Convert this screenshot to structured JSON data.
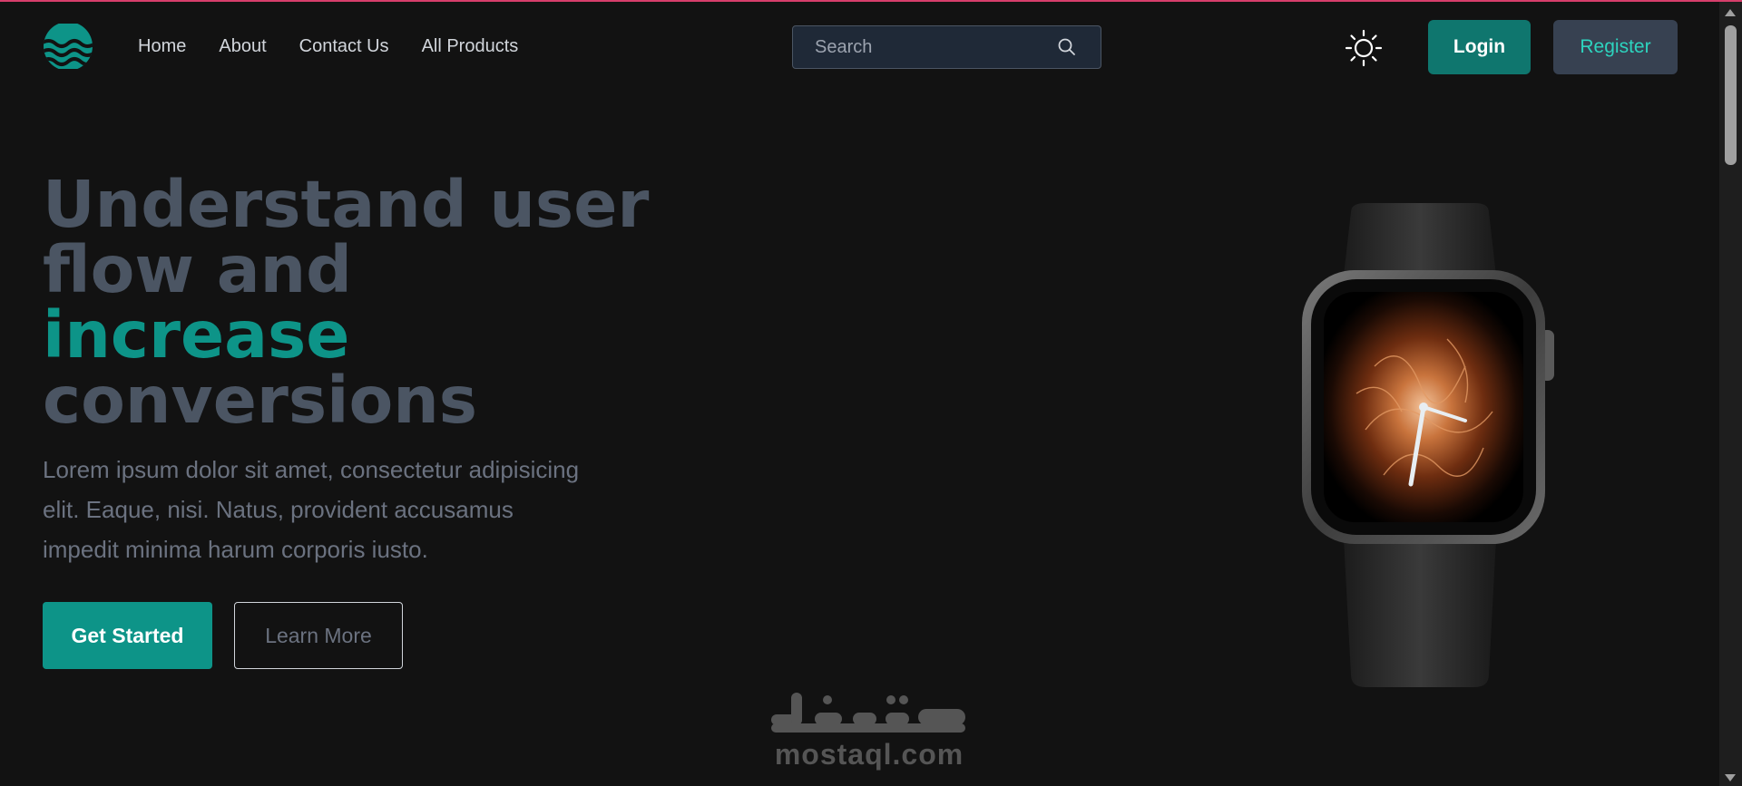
{
  "nav": {
    "links": [
      {
        "label": "Home"
      },
      {
        "label": "About"
      },
      {
        "label": "Contact Us"
      },
      {
        "label": "All Products"
      }
    ],
    "search_placeholder": "Search",
    "login_label": "Login",
    "register_label": "Register",
    "theme_icon": "sun-icon",
    "search_icon": "search-icon",
    "logo_icon": "wave-logo-icon"
  },
  "hero": {
    "title_line1": "Understand user",
    "title_line2": "flow and",
    "title_accent": "increase",
    "title_line4": "conversions",
    "description": "Lorem ipsum dolor sit amet, consectetur adipisicing elit. Eaque, nisi. Natus, provident accusamus impedit minima harum corporis iusto.",
    "primary_cta": "Get Started",
    "secondary_cta": "Learn More",
    "image_icon": "smartwatch-image"
  },
  "watermark": {
    "arabic": "مستقل",
    "domain": "mostaql.com"
  },
  "colors": {
    "accent": "#0d9488",
    "login_bg": "#0f766e",
    "register_bg": "#374151",
    "register_text": "#2dd4bf",
    "background": "#121212",
    "top_border": "#d63e6b",
    "title_muted": "#4b5563"
  }
}
